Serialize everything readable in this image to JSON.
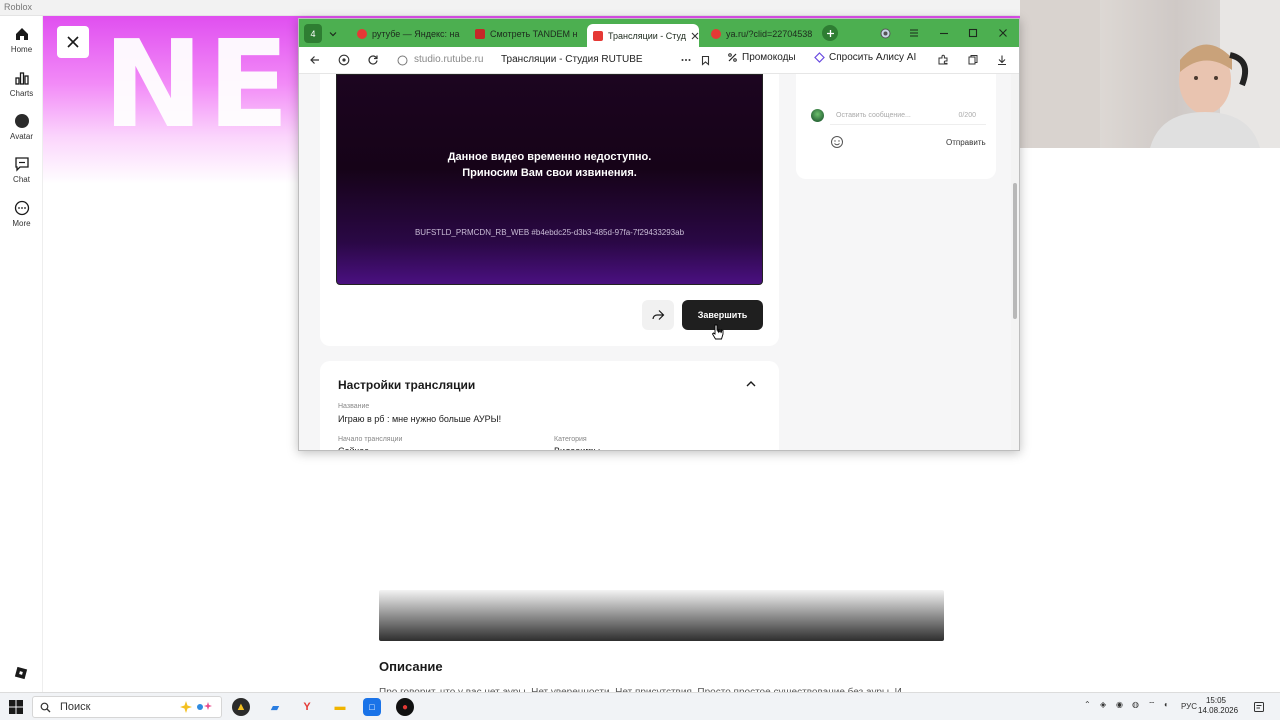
{
  "roblox": {
    "window_title": "Roblox",
    "nav": [
      {
        "label": "Home",
        "icon": "home-icon"
      },
      {
        "label": "Charts",
        "icon": "charts-icon"
      },
      {
        "label": "Avatar",
        "icon": "avatar-icon"
      },
      {
        "label": "Chat",
        "icon": "chat-icon"
      },
      {
        "label": "More",
        "icon": "more-icon"
      }
    ],
    "banner_text": "NE",
    "description_title": "Описание",
    "description_text": "Про говорит, что у вас нет ауры. Нет уверенности. Нет присутствия. Просто простое существование без ауры. И"
  },
  "browser": {
    "workspace_badge": "4",
    "tabs": [
      {
        "label": "рутубе — Яндекс: на",
        "active": false,
        "color": "#e53935"
      },
      {
        "label": "Смотреть TANDEM н",
        "active": false,
        "color": "#c62828"
      },
      {
        "label": "Трансляции - Студ",
        "active": true,
        "color": "#e53935"
      },
      {
        "label": "ya.ru/?clid=22704538",
        "active": false,
        "color": "#e53935"
      }
    ],
    "address_url": "studio.rutube.ru",
    "address_title": "Трансляции - Студия RUTUBE",
    "promo_label": "Промокоды",
    "alice_label": "Спросить Алису AI"
  },
  "player": {
    "message_line1": "Данное видео временно недоступно.",
    "message_line2": "Приносим Вам свои извинения.",
    "error_code": "BUFSTLD_PRMCDN_RB_WEB #b4ebdc25-d3b3-485d-97fa-7f29433293ab",
    "end_button": "Завершить"
  },
  "settings": {
    "title": "Настройки трансляции",
    "name_label": "Название",
    "name_value": "Играю в рб : мне нужно больше АУРЫ!",
    "start_label": "Начало трансляции",
    "start_value": "Сейчас",
    "category_label": "Категория",
    "category_value": "Видеоигры"
  },
  "chat": {
    "placeholder": "Оставить сообщение...",
    "counter": "0/200",
    "send_label": "Отправить"
  },
  "taskbar": {
    "search_label": "Поиск",
    "lang": "РУС",
    "time": "15:05",
    "date": "14.08.2026"
  },
  "colors": {
    "tab_strip": "#4caf50",
    "rutube_red": "#e53935",
    "banner_pink": "#e04ff0"
  }
}
